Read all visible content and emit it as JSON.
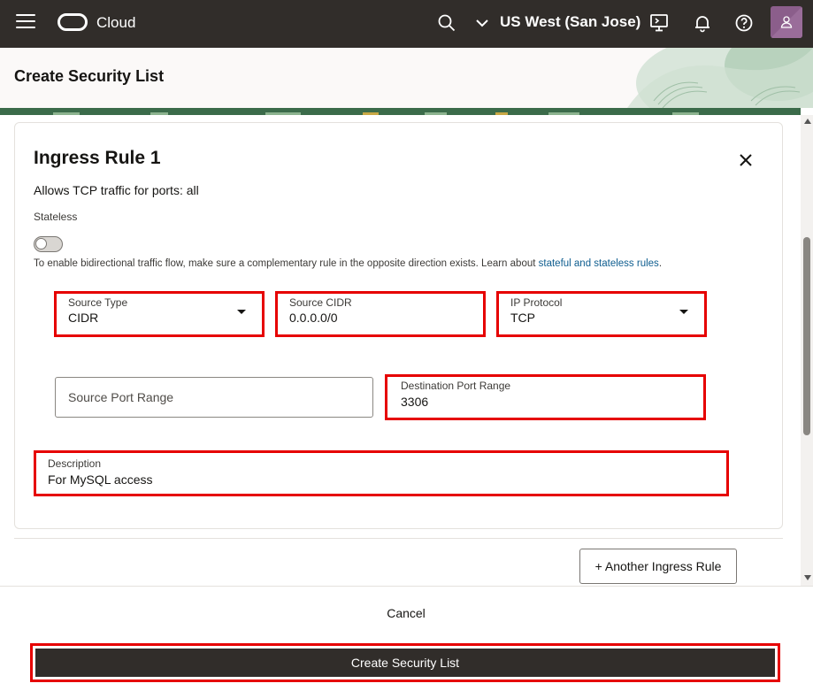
{
  "topbar": {
    "brand": "Cloud",
    "region": "US West (San Jose)",
    "icons": [
      "menu-icon",
      "oracle-logo",
      "search-icon",
      "chevron-down-icon",
      "cloud-shell-icon",
      "bell-icon",
      "help-icon",
      "user-icon"
    ]
  },
  "page": {
    "title": "Create Security List"
  },
  "rule": {
    "title": "Ingress Rule 1",
    "summary": "Allows TCP traffic for ports: all",
    "stateless_label": "Stateless",
    "stateless_on": false,
    "help_text": "To enable bidirectional traffic flow, make sure a complementary rule in the opposite direction exists. Learn about ",
    "help_link": "stateful and stateless rules",
    "help_end": ".",
    "source_type": {
      "label": "Source Type",
      "value": "CIDR"
    },
    "source_cidr": {
      "label": "Source CIDR",
      "value": "0.0.0.0/0"
    },
    "ip_protocol": {
      "label": "IP Protocol",
      "value": "TCP"
    },
    "source_port_range": {
      "placeholder": "Source Port Range"
    },
    "destination_port_range": {
      "label": "Destination Port Range",
      "value": "3306"
    },
    "description": {
      "label": "Description",
      "value": "For MySQL access"
    }
  },
  "actions": {
    "add_rule": "+ Another Ingress Rule",
    "cancel": "Cancel",
    "create": "Create Security List"
  },
  "colors": {
    "topbar": "#312d2a",
    "highlight": "#e60000",
    "link": "#0e5d8f"
  }
}
